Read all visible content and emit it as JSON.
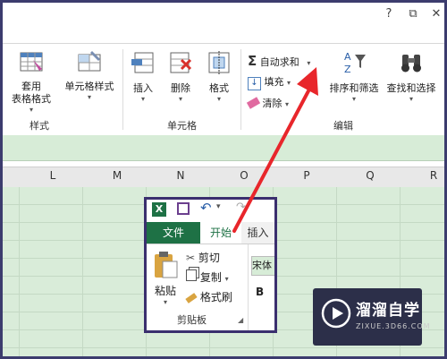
{
  "window": {
    "help": "?",
    "restore": "⧉",
    "close": "✕"
  },
  "ribbon": {
    "styles_group": {
      "format_table": "套用\n表格格式",
      "cell_styles": "单元格样式",
      "label": "样式"
    },
    "cells_group": {
      "insert": "插入",
      "delete": "删除",
      "format": "格式",
      "label": "单元格"
    },
    "editing_group": {
      "autosum": "自动求和",
      "fill": "填充",
      "clear": "清除",
      "sort_filter": "排序和筛选",
      "find_select": "查找和选择",
      "label": "编辑"
    }
  },
  "columns": [
    "L",
    "M",
    "N",
    "O",
    "P",
    "Q",
    "R"
  ],
  "inset": {
    "file_tab": "文件",
    "home_tab": "开始",
    "insert_tab": "插入",
    "paste": "粘贴",
    "cut": "剪切",
    "copy": "复制",
    "format_painter": "格式刷",
    "clipboard_label": "剪贴板",
    "font_name": "宋体",
    "bold": "B"
  },
  "watermark": {
    "title": "溜溜自学",
    "url": "ZIXUE.3D66.COM"
  },
  "colors": {
    "accent_red": "#e8262b",
    "excel_green": "#1e7145",
    "sheet_green": "#d9ecd9",
    "frame": "#3c3c6e"
  }
}
